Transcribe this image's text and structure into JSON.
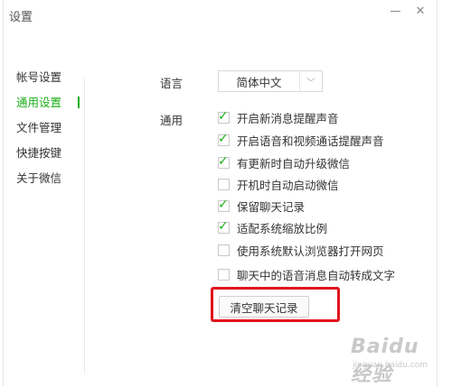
{
  "window": {
    "title": "设置"
  },
  "controls": {
    "minimize_icon": "minimize-icon",
    "close_icon": "close-icon",
    "close_glyph": "✕"
  },
  "sidebar": {
    "items": [
      {
        "label": "帐号设置",
        "active": false
      },
      {
        "label": "通用设置",
        "active": true
      },
      {
        "label": "文件管理",
        "active": false
      },
      {
        "label": "快捷按键",
        "active": false
      },
      {
        "label": "关于微信",
        "active": false
      }
    ],
    "accent_color": "#1aad19"
  },
  "main": {
    "language": {
      "label": "语言",
      "selected": "简体中文",
      "arrow_glyph": "﹀"
    },
    "general": {
      "label": "通用",
      "options": [
        {
          "label": "开启新消息提醒声音",
          "checked": true
        },
        {
          "label": "开启语音和视频通话提醒声音",
          "checked": true
        },
        {
          "label": "有更新时自动升级微信",
          "checked": true
        },
        {
          "label": "开机时自动启动微信",
          "checked": false
        },
        {
          "label": "保留聊天记录",
          "checked": true
        },
        {
          "label": "适配系统缩放比例",
          "checked": true
        },
        {
          "label": "使用系统默认浏览器打开网页",
          "checked": false
        },
        {
          "label": "聊天中的语音消息自动转成文字",
          "checked": false
        }
      ],
      "check_glyph": "✓"
    },
    "clear_button": {
      "label": "清空聊天记录"
    },
    "highlight_color": "#e0141e"
  },
  "watermark": {
    "main": "Baidu 经验",
    "sub": "jingyan.baidu.com"
  }
}
